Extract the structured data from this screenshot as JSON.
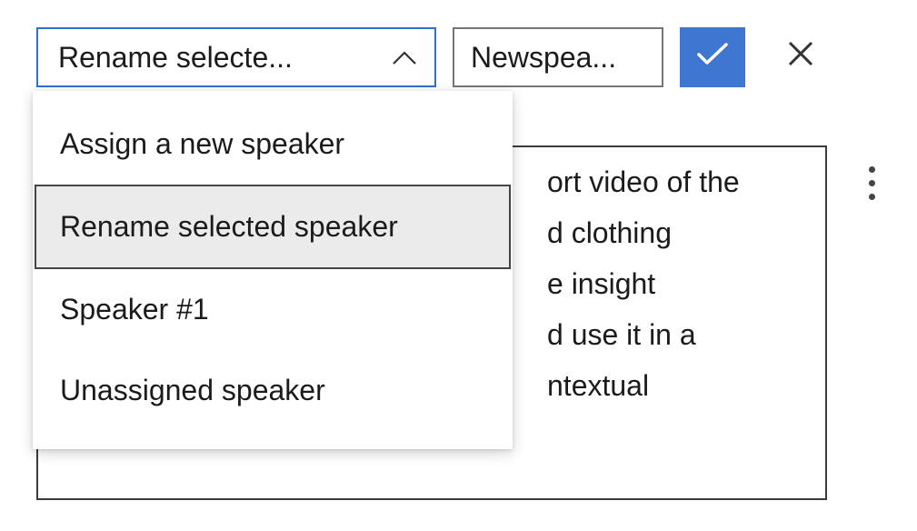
{
  "toolbar": {
    "dropdown_selected_label": "Rename selecte...",
    "speaker_input_value": "Newspea..."
  },
  "dropdown": {
    "items": [
      {
        "label": "Assign a new speaker"
      },
      {
        "label": "Rename selected speaker"
      },
      {
        "label": "Speaker #1"
      },
      {
        "label": "Unassigned speaker"
      }
    ],
    "selected_index": 1
  },
  "transcript": {
    "visible_text": "ort video of the\nd clothing\ne insight\nd use it in a\nntextual"
  }
}
